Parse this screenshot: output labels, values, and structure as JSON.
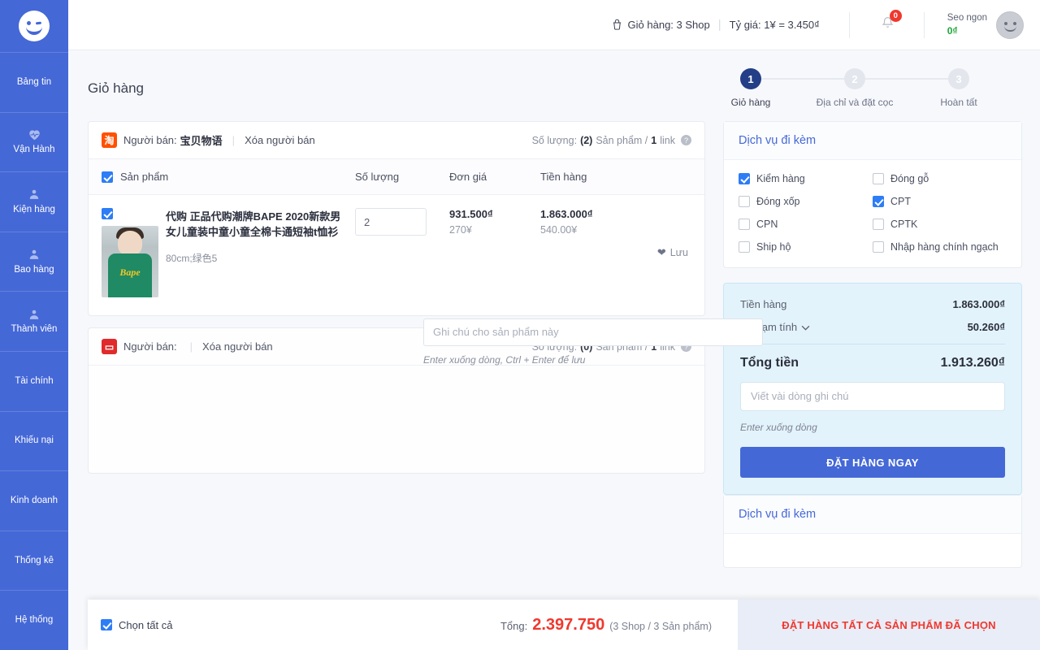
{
  "sidebar": {
    "logo_icon": "wink-smiley-logo",
    "items": [
      {
        "label": "Bảng tin",
        "icon": ""
      },
      {
        "label": "Vận Hành",
        "icon": "heartbeat-icon"
      },
      {
        "label": "Kiện hàng",
        "icon": "user-icon"
      },
      {
        "label": "Bao hàng",
        "icon": "user-icon"
      },
      {
        "label": "Thành viên",
        "icon": "user-icon"
      },
      {
        "label": "Tài chính",
        "icon": ""
      },
      {
        "label": "Khiếu nại",
        "icon": ""
      },
      {
        "label": "Kinh doanh",
        "icon": ""
      },
      {
        "label": "Thống kê",
        "icon": ""
      },
      {
        "label": "Hệ thống",
        "icon": ""
      }
    ]
  },
  "header": {
    "basket_icon": "basket-icon",
    "cart_text": "Giỏ hàng: 3 Shop",
    "rate_text": "Tỷ giá: 1¥ = 3.450₫",
    "bell_icon": "bell-icon",
    "bell_badge": "0",
    "user_name": "Seo ngon",
    "user_balance": "0₫",
    "avatar_icon": "avatar-smiley"
  },
  "page": {
    "title": "Giỏ hàng",
    "steps": [
      {
        "num": "1",
        "label": "Giỏ hàng"
      },
      {
        "num": "2",
        "label": "Địa chỉ và đặt cọc"
      },
      {
        "num": "3",
        "label": "Hoàn tất"
      }
    ]
  },
  "cart": {
    "seller": {
      "shop_icon": "taobao-icon",
      "shop_icon_glyph": "淘",
      "prefix": "Người bán:",
      "name": "宝贝物语",
      "delete_label": "Xóa người bán",
      "count_prefix": "Số lượng:",
      "count_value": "(2)",
      "count_mid": "Sản phẩm /",
      "links": "1",
      "count_suffix": "link",
      "help_icon": "question-mark-icon"
    },
    "columns": {
      "product": "Sản phẩm",
      "quantity": "Số lượng",
      "unit_price": "Đơn giá",
      "amount": "Tiền hàng"
    },
    "item": {
      "name": "代购 正品代购潮牌BAPE 2020新款男女儿童装中童小童全棉卡通短袖t恤衫",
      "attrs": "80cm;绿色5",
      "quantity": "2",
      "unit_price_vnd": "931.500₫",
      "unit_price_cny": "270¥",
      "amount_vnd": "1.863.000₫",
      "amount_cny": "540.00¥",
      "save_icon": "heart-icon",
      "save_label": "Lưu",
      "note_placeholder": "Ghi chú cho sản phẩm này",
      "note_hint": "Enter xuống dòng, Ctrl + Enter để lưu",
      "thumb_logo": "Bape"
    },
    "seller2": {
      "shop_icon": "shop-icon-red",
      "prefix": "Người bán:",
      "name": "",
      "delete_label": "Xóa người bán",
      "count_prefix": "Số lượng:",
      "count_value": "(0)",
      "count_mid": "Sản phẩm /",
      "links": "1",
      "count_suffix": "link"
    }
  },
  "services": {
    "title": "Dịch vụ đi kèm",
    "items": [
      {
        "label": "Kiểm hàng",
        "checked": true
      },
      {
        "label": "Đóng gỗ",
        "checked": false
      },
      {
        "label": "Đóng xốp",
        "checked": false
      },
      {
        "label": "CPT",
        "checked": true
      },
      {
        "label": "CPN",
        "checked": false
      },
      {
        "label": "CPTK",
        "checked": false
      },
      {
        "label": "Ship hộ",
        "checked": false
      },
      {
        "label": "Nhập hàng chính ngạch",
        "checked": false
      }
    ]
  },
  "summary": {
    "goods_label": "Tiền hàng",
    "goods_value": "1.863.000₫",
    "fee_label": "Phí tạm tính",
    "fee_chevron": "chevron-down-icon",
    "fee_value": "50.260₫",
    "total_label": "Tổng tiền",
    "total_value": "1.913.260₫",
    "note_placeholder": "Viết vài dòng ghi chú",
    "note_hint": "Enter xuống dòng",
    "order_button": "ĐẶT HÀNG NGAY"
  },
  "bottom": {
    "select_all": "Chọn tất cả",
    "total_label": "Tổng:",
    "total_value": "2.397.750",
    "total_sub": "(3 Shop / 3 Sản phẩm)",
    "order_all": "ĐẶT HÀNG TẤT CẢ SẢN PHẨM ĐÃ CHỌN"
  },
  "colors": {
    "sidebar": "#4568d7",
    "primary": "#4568d7",
    "step_active": "#243e87",
    "danger": "#f0382e",
    "checkbox": "#2d7df6",
    "summary_bg": "#e3f3fc",
    "green_tab": "#67a80d",
    "balance_green": "#1da63a"
  }
}
